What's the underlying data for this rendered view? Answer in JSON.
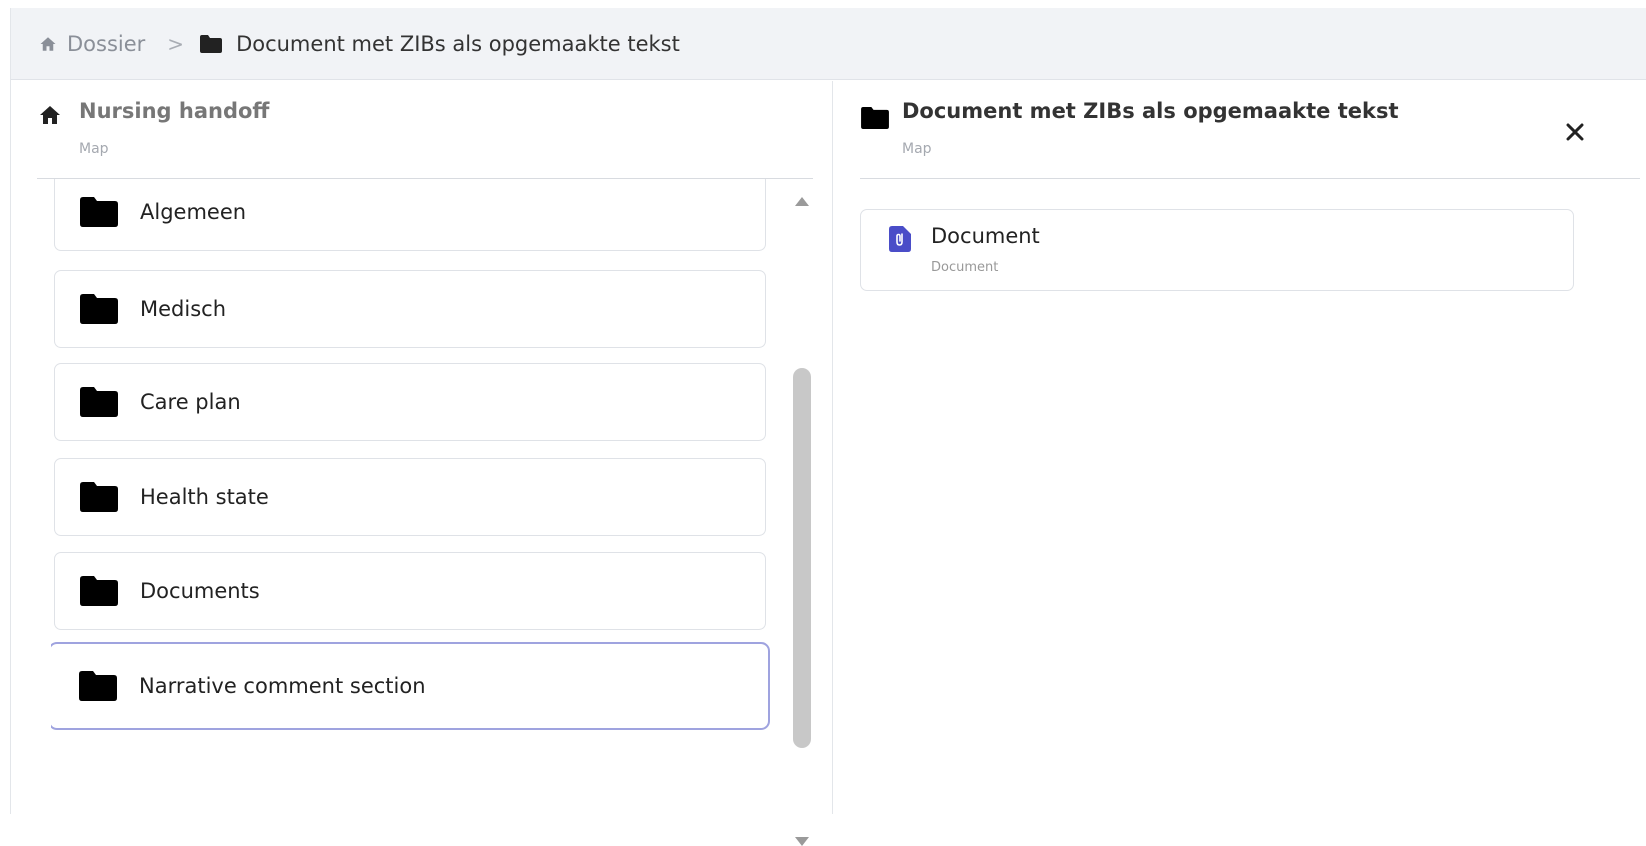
{
  "breadcrumb": {
    "home_icon": "home-icon",
    "root_label": "Dossier",
    "separator": ">",
    "folder_icon": "folder-icon",
    "current_label": "Document met ZIBs als opgemaakte tekst"
  },
  "left_panel": {
    "icon": "home-icon",
    "title": "Nursing handoff",
    "subtitle": "Map",
    "folders": [
      {
        "label": "Algemeen",
        "icon": "folder-icon"
      },
      {
        "label": "Medisch",
        "icon": "folder-icon"
      },
      {
        "label": "Care plan",
        "icon": "folder-icon"
      },
      {
        "label": "Health state",
        "icon": "folder-icon"
      },
      {
        "label": "Documents",
        "icon": "folder-icon"
      },
      {
        "label": "Narrative comment section",
        "icon": "folder-icon",
        "selected": true
      }
    ]
  },
  "right_panel": {
    "icon": "folder-icon",
    "title": "Document met ZIBs als opgemaakte tekst",
    "subtitle": "Map",
    "close_icon": "close-icon",
    "items": [
      {
        "title": "Document",
        "subtitle": "Document",
        "icon": "document-attachment-icon"
      }
    ]
  },
  "colors": {
    "breadcrumb_bg": "#f1f3f6",
    "selected_border": "#9fa3df",
    "document_icon": "#4a4dc8"
  }
}
